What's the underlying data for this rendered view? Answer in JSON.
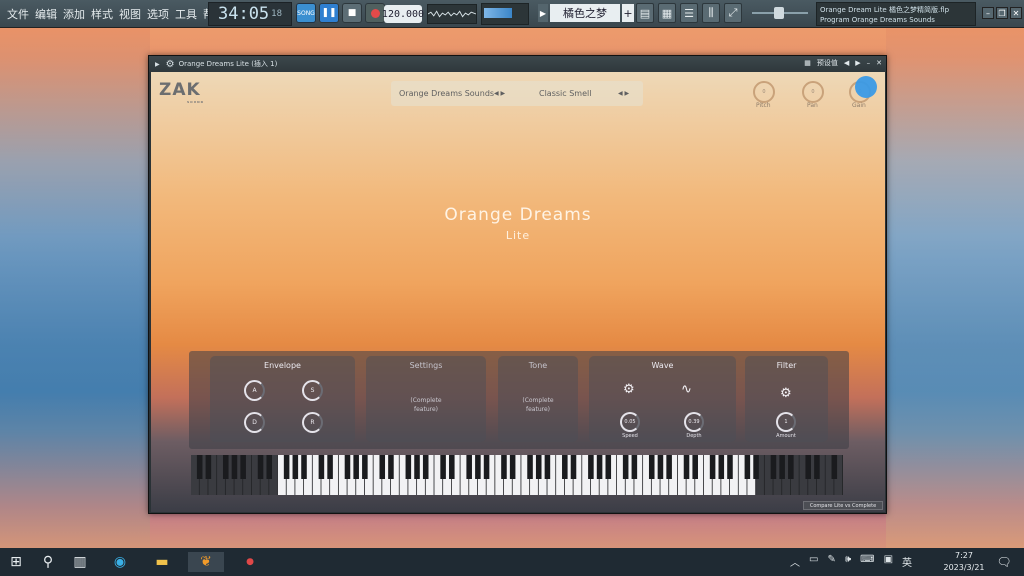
{
  "topbar": {
    "menu": [
      "文件",
      "编辑",
      "添加",
      "样式",
      "视图",
      "选项",
      "工具",
      "帮助"
    ],
    "clock": "34:05",
    "clock_sub": "18",
    "song_label": "SONG",
    "tempo": "120.000",
    "pattern_name": "橘色之梦",
    "hint_line1": "Orange Dream Lite 橘色之梦精简版.flp",
    "hint_line2": "Program  Orange Dreams Sounds"
  },
  "plugin_window": {
    "title": "Orange Dreams Lite (插入 1)",
    "preset_label": "预设值"
  },
  "plugin": {
    "logo": "ZAK",
    "preset_bank": "Orange Dreams Sounds",
    "preset_name": "Classic Smell",
    "knobs": {
      "pitch": {
        "label": "Pitch",
        "value": "0"
      },
      "pan": {
        "label": "Pan",
        "value": "0"
      },
      "gain": {
        "label": "Gain",
        "value": "0"
      }
    },
    "title": "Orange Dreams",
    "subtitle": "Lite",
    "sections": {
      "envelope": {
        "title": "Envelope",
        "knobs": [
          "A",
          "S",
          "D",
          "R"
        ]
      },
      "settings": {
        "title": "Settings",
        "text": "(Complete feature)"
      },
      "tone": {
        "title": "Tone",
        "text": "(Complete feature)"
      },
      "wave": {
        "title": "Wave",
        "speed_label": "Speed",
        "speed_value": "0.05",
        "depth_label": "Depth",
        "depth_value": "0.39"
      },
      "filter": {
        "title": "Filter",
        "amount_label": "Amount",
        "amount_value": "1"
      }
    },
    "compare_button": "Compare Lite vs Complete"
  },
  "taskbar": {
    "ime": "英",
    "time": "7:27",
    "date": "2023/3/21"
  }
}
